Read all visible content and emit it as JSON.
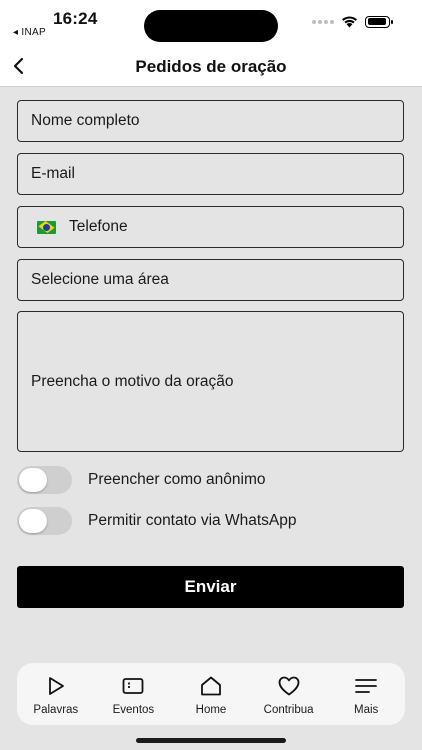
{
  "status_bar": {
    "time": "16:24",
    "carrier": "◂ INAP"
  },
  "header": {
    "title": "Pedidos de oração"
  },
  "form": {
    "full_name_placeholder": "Nome completo",
    "email_placeholder": "E-mail",
    "phone_placeholder": "Telefone",
    "area_placeholder": "Selecione uma área",
    "reason_placeholder": "Preencha o motivo da oração",
    "anonymous_label": "Preencher como anônimo",
    "whatsapp_label": "Permitir contato via WhatsApp",
    "anonymous_on": false,
    "whatsapp_on": false,
    "submit_label": "Enviar"
  },
  "tabbar": {
    "items": [
      {
        "label": "Palavras",
        "icon": "play-icon"
      },
      {
        "label": "Eventos",
        "icon": "ticket-icon"
      },
      {
        "label": "Home",
        "icon": "home-icon"
      },
      {
        "label": "Contribua",
        "icon": "heart-icon"
      },
      {
        "label": "Mais",
        "icon": "menu-icon"
      }
    ]
  }
}
